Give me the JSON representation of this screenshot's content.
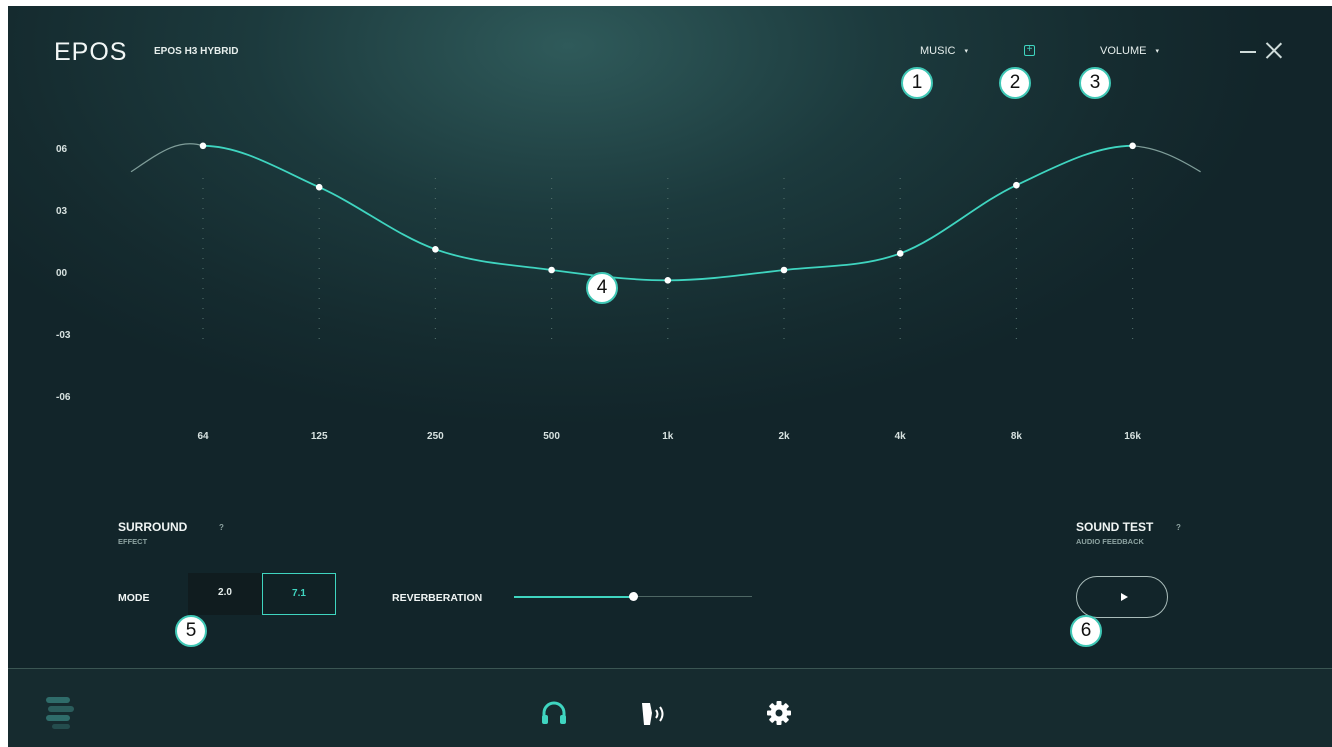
{
  "header": {
    "logo": "EPOS",
    "device_name": "EPOS H3 HYBRID",
    "preset": {
      "label": "MUSIC",
      "caret": "▾"
    },
    "add_preset": "+",
    "volume": {
      "label": "VOLUME",
      "caret": "▾"
    }
  },
  "callouts": [
    "1",
    "2",
    "3",
    "4",
    "5",
    "6"
  ],
  "equalizer": {
    "y_labels": [
      "06",
      "03",
      "00",
      "-03",
      "-06"
    ],
    "x_labels": [
      "64",
      "125",
      "250",
      "500",
      "1k",
      "2k",
      "4k",
      "8k",
      "16k"
    ],
    "gains_db": [
      6,
      4,
      1,
      0,
      -0.5,
      0,
      0.8,
      4.1,
      6
    ],
    "accent_color": "#3fd5c0"
  },
  "surround": {
    "title": "SURROUND",
    "help": "?",
    "subtitle": "EFFECT",
    "mode_label": "MODE",
    "modes": [
      "2.0",
      "7.1"
    ],
    "selected_mode": "7.1",
    "reverb_label": "REVERBERATION",
    "reverb_level": 0.5
  },
  "sound_test": {
    "title": "SOUND TEST",
    "help": "?",
    "subtitle": "AUDIO FEEDBACK"
  },
  "footer": {
    "icons": [
      "menu-icon",
      "headset-icon",
      "mic-sidetone-icon",
      "settings-icon"
    ],
    "active": "headset-icon"
  }
}
